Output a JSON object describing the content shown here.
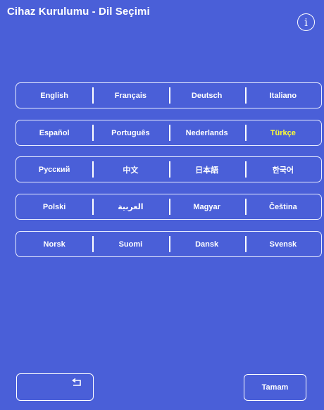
{
  "header": {
    "title": "Cihaz Kurulumu - Dil Seçimi",
    "info_icon": "info-icon",
    "info_glyph": "i"
  },
  "languages": {
    "rows": [
      [
        "English",
        "Français",
        "Deutsch",
        "Italiano"
      ],
      [
        "Español",
        "Português",
        "Nederlands",
        "Türkçe"
      ],
      [
        "Русский",
        "中文",
        "日本語",
        "한국어"
      ],
      [
        "Polski",
        "العربية",
        "Magyar",
        "Čeština"
      ],
      [
        "Norsk",
        "Suomi",
        "Dansk",
        "Svensk"
      ]
    ],
    "selected": "Türkçe"
  },
  "footer": {
    "back_icon": "return-arrow-icon",
    "ok_label": "Tamam"
  },
  "colors": {
    "background": "#4a5fd8",
    "text": "#ffffff",
    "selected_text": "#ffff33",
    "border": "#ffffff"
  }
}
